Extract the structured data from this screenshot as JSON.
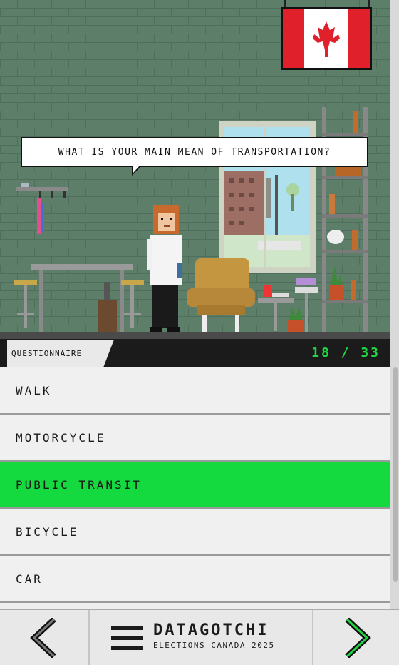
{
  "scene": {
    "question": "What is your main mean of transportation?",
    "flag": "canada-flag"
  },
  "status": {
    "section_label": "Questionnaire",
    "progress_text": "18 / 33",
    "current": 18,
    "total": 33,
    "progress_color": "#22d440"
  },
  "options": [
    {
      "label": "Walk",
      "selected": false
    },
    {
      "label": "Motorcycle",
      "selected": false
    },
    {
      "label": "Public transit",
      "selected": true
    },
    {
      "label": "Bicycle",
      "selected": false
    },
    {
      "label": "Car",
      "selected": false
    }
  ],
  "nav": {
    "prev_icon": "chevron-left-icon",
    "next_icon": "chevron-right-icon",
    "menu_icon": "hamburger-menu-icon",
    "brand_title": "Datagotchi",
    "brand_subtitle": "Elections Canada 2025"
  },
  "colors": {
    "selected_option": "#14d93f",
    "next_arrow": "#22d440",
    "wall": "#5a7b66"
  }
}
